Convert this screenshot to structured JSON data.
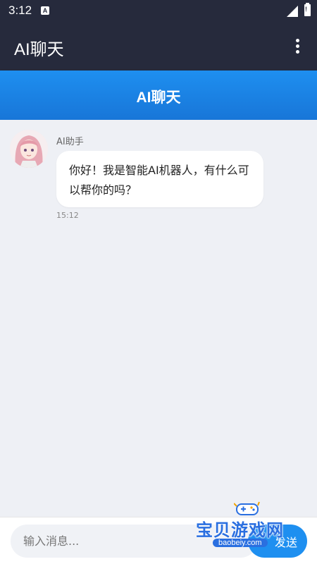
{
  "status_bar": {
    "time": "3:12",
    "notification_icon": "a-box-icon",
    "signal_icon": "signal-icon",
    "battery_icon": "battery-icon"
  },
  "app_bar": {
    "title": "AI聊天",
    "menu_icon": "more-vert-icon"
  },
  "page_header": {
    "title": "AI聊天"
  },
  "messages": [
    {
      "sender": "AI助手",
      "text": "你好！我是智能AI机器人，有什么可以帮你的吗？",
      "time": "15:12",
      "avatar": "anime-avatar"
    }
  ],
  "input": {
    "placeholder": "输入消息...",
    "value": "",
    "send_label": "发送"
  },
  "watermark": {
    "text": "宝贝游戏网",
    "url": "baobeiy.com",
    "icon": "gamepad-icon"
  },
  "colors": {
    "status_bar": "#262a3c",
    "header_blue": "#1e8ff0",
    "background": "#eef0f5",
    "bubble": "#ffffff"
  }
}
